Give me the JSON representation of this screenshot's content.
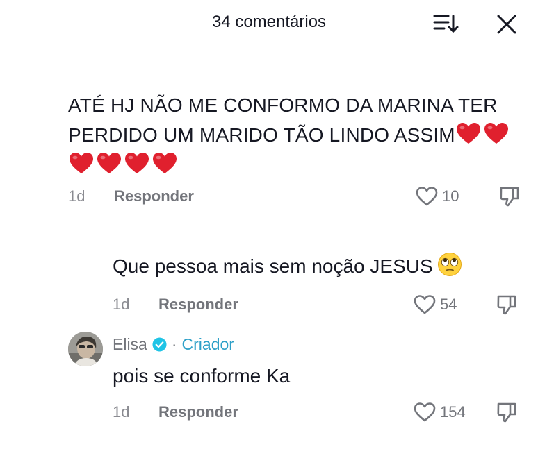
{
  "header": {
    "title": "34 comentários",
    "sort_icon": "sort-list-icon",
    "close_icon": "close-icon"
  },
  "comments": [
    {
      "text": "ATÉ HJ NÃO ME CONFORMO DA MARINA TER PERDIDO UM MARIDO TÃO LINDO ASSIM",
      "emoji": [
        "red-heart",
        "red-heart",
        "red-heart",
        "red-heart",
        "red-heart",
        "red-heart"
      ],
      "time": "1d",
      "reply_label": "Responder",
      "likes": "10"
    },
    {
      "text": "Que pessoa mais sem noção JESUS",
      "emoji": [
        "face-with-rolling-eyes"
      ],
      "time": "1d",
      "reply_label": "Responder",
      "likes": "54"
    },
    {
      "author": "Elisa",
      "author_tag_separator": "·",
      "author_tag": "Criador",
      "verified": true,
      "text": "pois se conforme Ka",
      "time": "1d",
      "reply_label": "Responder",
      "likes": "154"
    }
  ],
  "colors": {
    "text": "#161823",
    "meta": "#73757b",
    "creator": "#2ea0c8",
    "verified": "#20c4e6",
    "heart": "#e0202e"
  }
}
